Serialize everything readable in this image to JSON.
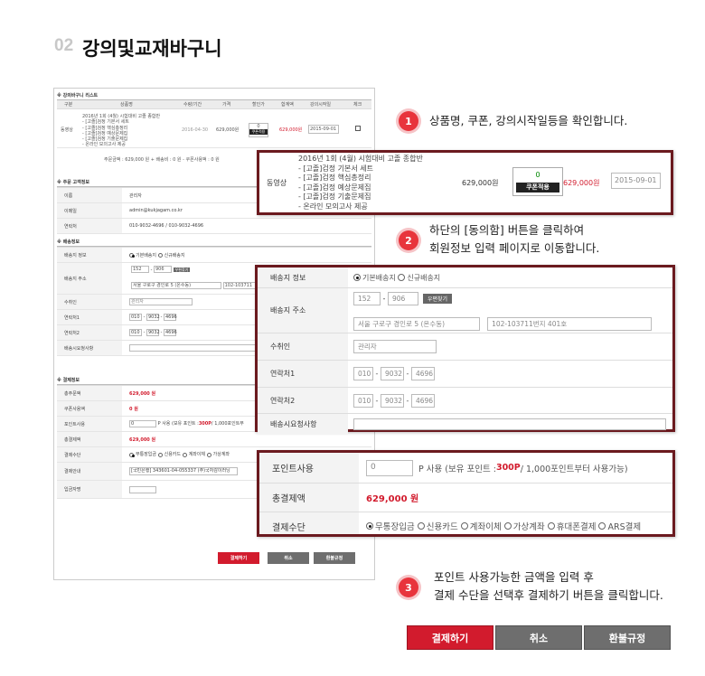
{
  "page_title": {
    "number": "02",
    "text": "강의및교재바구니"
  },
  "cart": {
    "section_title": "※ 강의바구니 리스트",
    "headers": [
      "구분",
      "상품명",
      "수량/기간",
      "가격",
      "할인가",
      "합계액",
      "강의시작일",
      "체크"
    ],
    "item": {
      "type": "동영상",
      "name_lines": [
        "2016년 1회 (4월) 시험대비 고졸 종합반",
        "- [고졸]검정 기본서 세트",
        "- [고졸]검정 핵심총정리",
        "- [고졸]검정 예상문제집",
        "- [고졸]검정 기출문제집",
        "- 온라인 모의고사 제공"
      ],
      "date_small": "2016-04-30",
      "price": "629,000원",
      "discount_value": "0",
      "coupon_label": "쿠폰적용",
      "total": "629,000원",
      "start_date": "2015-09-01"
    },
    "summary": "주문금액 : 629,000 원 + 배송비 : 0 원 - 쿠폰사용액 : 0 원"
  },
  "orderer": {
    "section_title": "※ 주문 고객정보",
    "rows": [
      {
        "label": "이름",
        "value": "관리자"
      },
      {
        "label": "이메일",
        "value": "admin@kukjagam.co.kr"
      },
      {
        "label": "연락처",
        "value": "010-9032-4696 / 010-9032-4696"
      }
    ]
  },
  "shipping": {
    "section_title": "※ 배송정보",
    "info_label": "배송지 정보",
    "radio_options": [
      "기본배송지",
      "신규배송지"
    ],
    "address_label": "배송지 주소",
    "zip1": "152",
    "zip2": "906",
    "zip_button": "우편찾기",
    "address1": "서울 구로구 경인로 5 (온수동)",
    "address2": "102-103711번지 401호",
    "address2_short": "102-103711",
    "recipient_label": "수취인",
    "recipient_value": "관리자",
    "phone1_label": "연락처1",
    "phone2_label": "연락처2",
    "phone_parts": [
      "010",
      "9032",
      "4696"
    ],
    "request_label": "배송시요청사항"
  },
  "payment": {
    "section_title": "※ 결제정보",
    "total_order_label": "총주문액",
    "total_order_value": "629,000 원",
    "coupon_label": "쿠폰사용액",
    "coupon_value": "0 원",
    "point_label": "포인트사용",
    "point_input": "0",
    "point_text_prefix": "P 사용 (보유 포인트 : ",
    "point_amount": "300P",
    "point_text_suffix": "/ 1,000포인트부터 사용가능)",
    "point_text_short_suffix": "/ 1,000포인트부",
    "total_pay_label": "총결제액",
    "total_pay_value": "629,000 원",
    "method_label": "결제수단",
    "methods": [
      "무통장입금",
      "신용카드",
      "계좌이체",
      "가상계좌",
      "휴대폰결제",
      "ARS결제"
    ],
    "methods_short": [
      "무통장입금",
      "신용카드",
      "계좌이체",
      "가상계좌"
    ],
    "account_label": "결제안내",
    "account_value": "[국민은행] 343601-04-055337 (주)국자감이러닝",
    "depositor_label": "입금자명"
  },
  "buttons": {
    "pay": "결제하기",
    "cancel": "취소",
    "refund": "환불규정"
  },
  "steps": [
    {
      "num": "1",
      "lines": [
        "상품명, 쿠폰, 강의시작일등을 확인합니다."
      ]
    },
    {
      "num": "2",
      "lines": [
        "하단의 [동의함] 버튼을 클릭하여",
        "회원정보 입력 페이지로 이동합니다."
      ]
    },
    {
      "num": "3",
      "lines": [
        "포인트 사용가능한 금액을 입력 후",
        "결제 수단을 선택후 결제하기 버튼을 클릭합니다."
      ]
    }
  ],
  "colors": {
    "accent_red": "#d21b2d",
    "frame": "#6b1a1f",
    "step_circle": "#e8343c",
    "button_gray": "#6e6e6e"
  }
}
